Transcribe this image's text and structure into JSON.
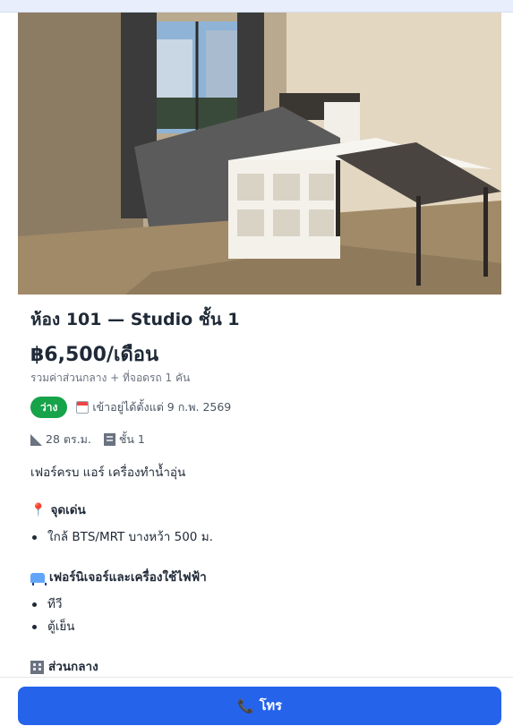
{
  "listing": {
    "title": "ห้อง 101 — Studio ชั้น 1",
    "price": "฿6,500/เดือน",
    "price_note": "รวมค่าส่วนกลาง + ที่จอดรถ 1 คัน",
    "status_badge": "ว่าง",
    "move_in": "เข้าอยู่ได้ตั้งแต่ 9 ก.พ. 2569",
    "area": "28 ตร.ม.",
    "floor": "ชั้น 1",
    "description": "เฟอร์ครบ แอร์ เครื่องทำน้ำอุ่น"
  },
  "sections": {
    "highlights": {
      "title": "จุดเด่น",
      "items": [
        "ใกล้ BTS/MRT บางหว้า 500 ม."
      ]
    },
    "furniture": {
      "title": "เฟอร์นิเจอร์และเครื่องใช้ไฟฟ้า",
      "items": [
        "ทีวี",
        "ตู้เย็น"
      ]
    },
    "common": {
      "title": "ส่วนกลาง"
    }
  },
  "footer": {
    "call_label": "โทร"
  },
  "colors": {
    "status_green": "#16a34a",
    "call_blue": "#2563eb"
  },
  "icons": {
    "move_in": "calendar-icon",
    "area": "ruler-icon",
    "floor": "building-icon",
    "highlights": "pin-icon",
    "furniture": "sofa-icon",
    "common": "office-building-icon",
    "call": "phone-icon"
  }
}
